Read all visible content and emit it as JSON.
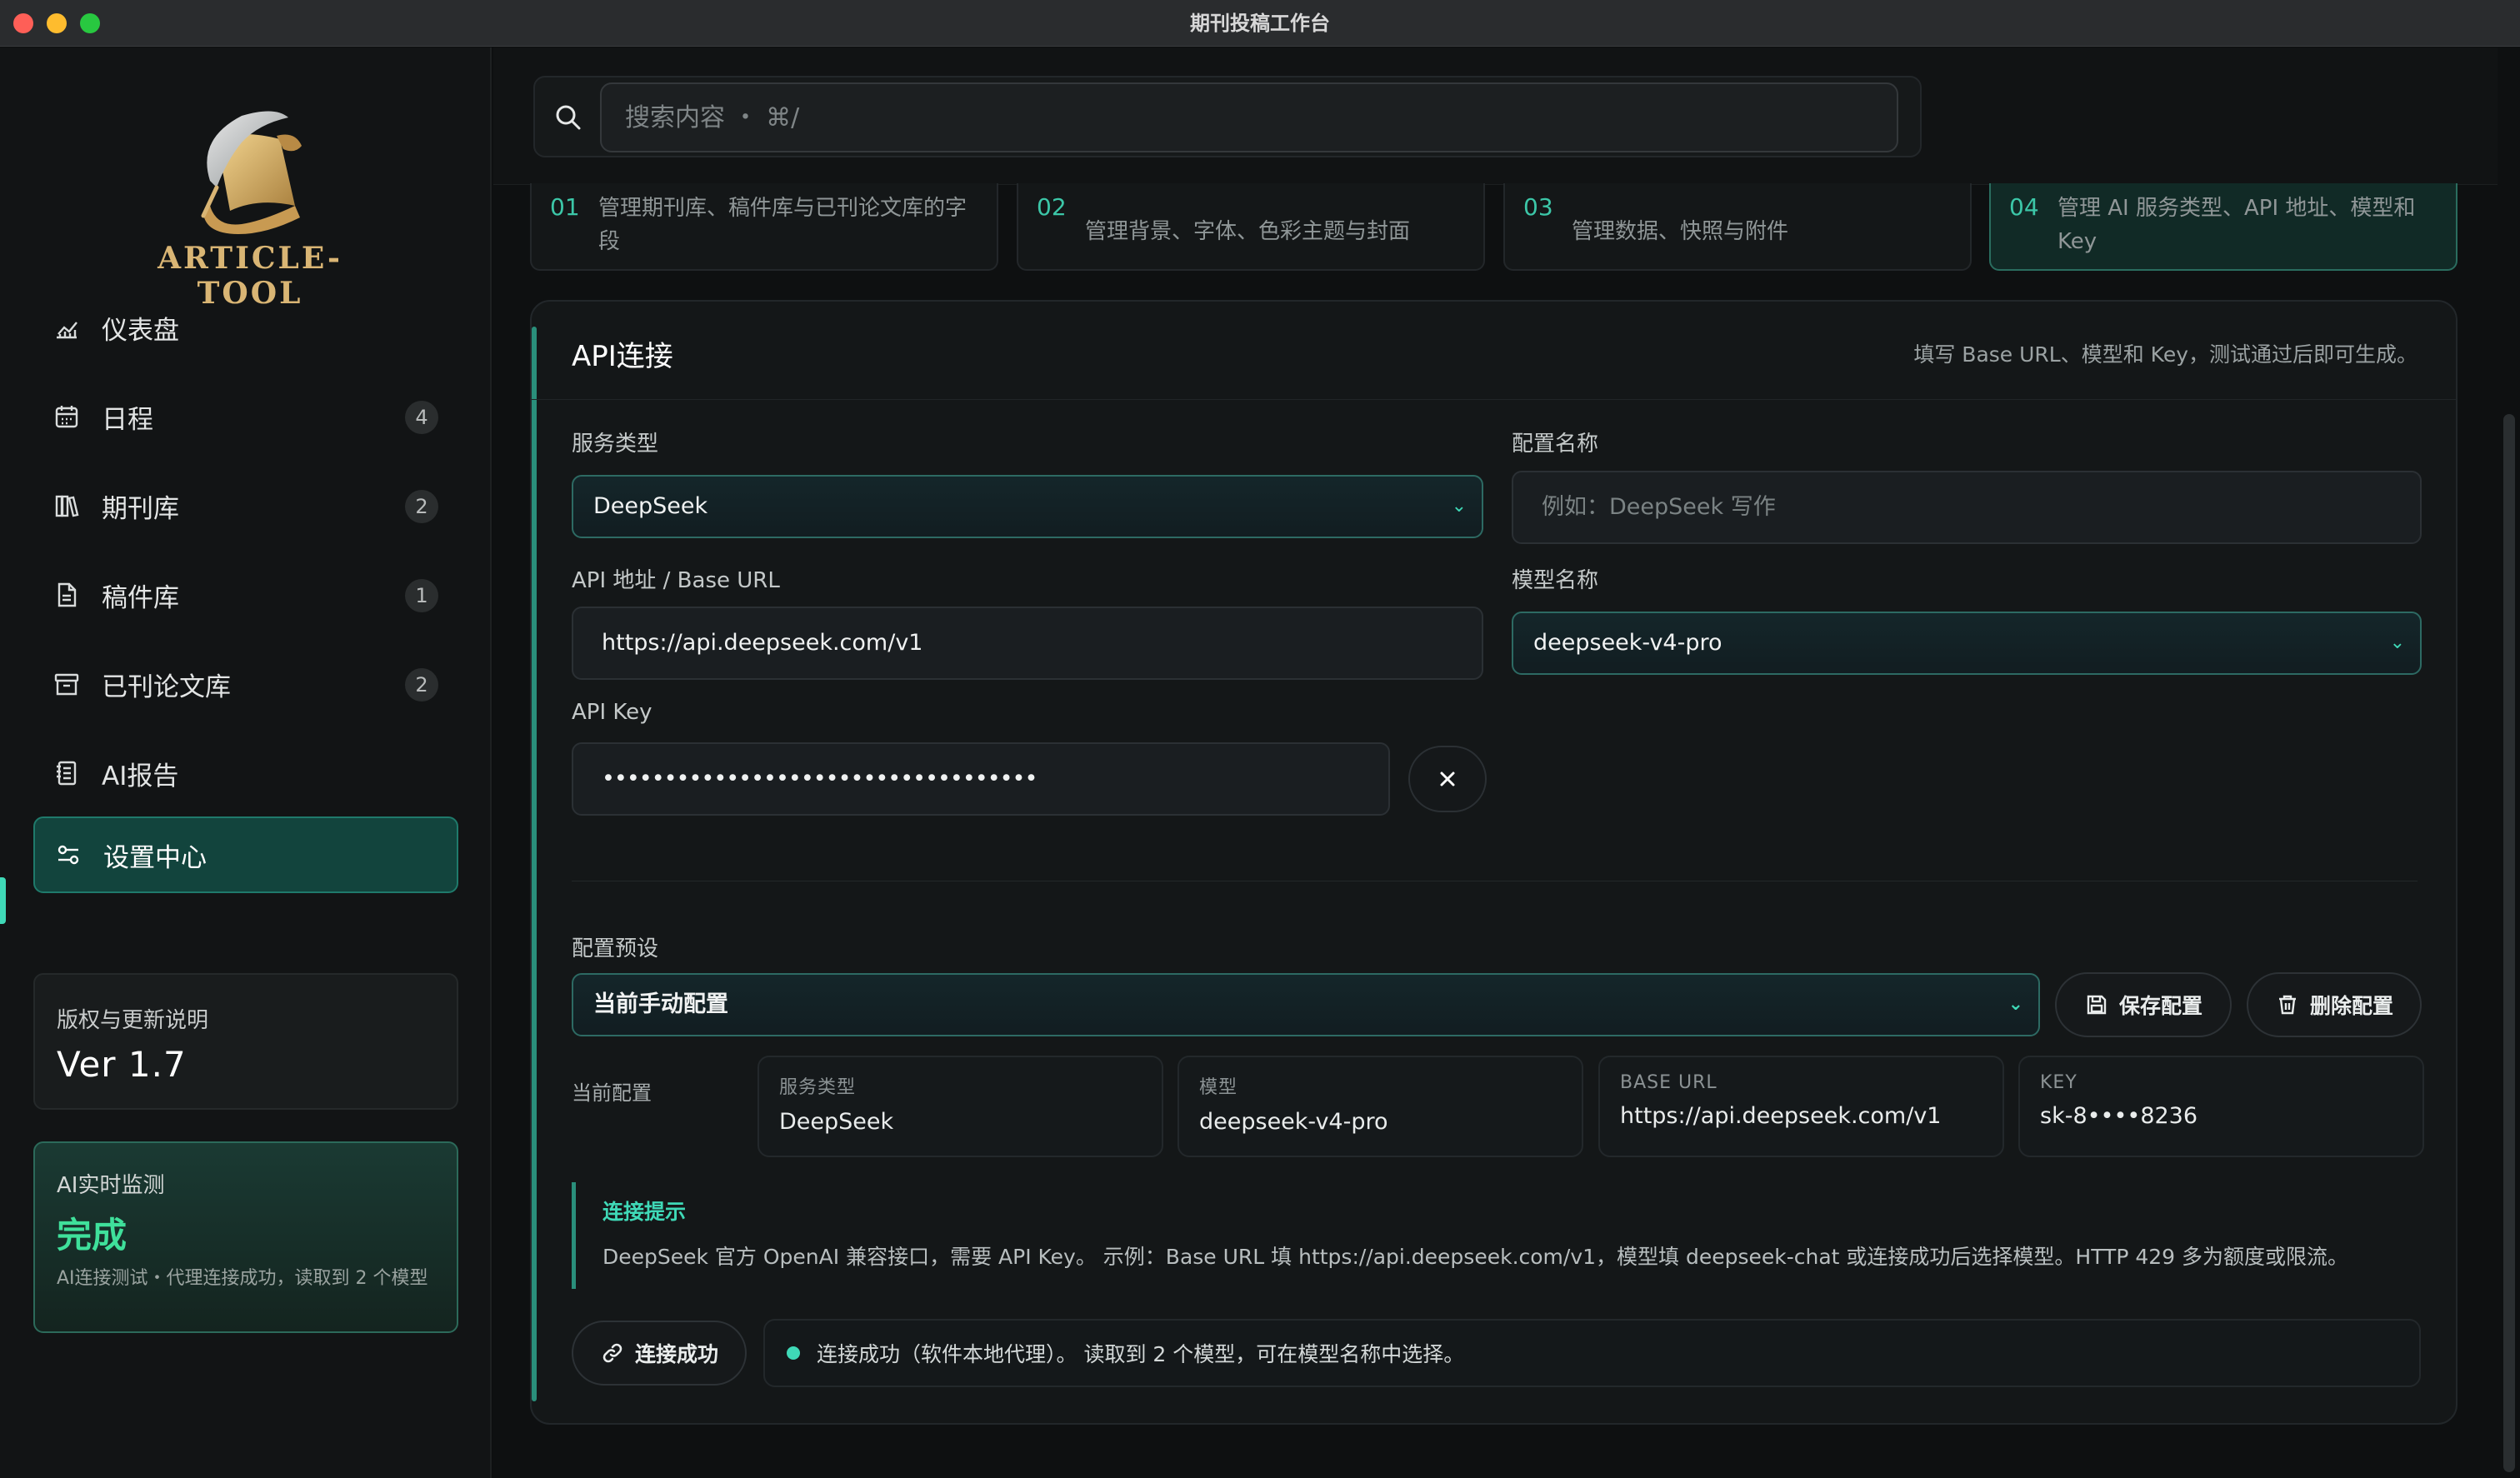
{
  "window": {
    "title": "期刊投稿工作台"
  },
  "brand": {
    "logo_text": "ARTICLE-TOOL"
  },
  "sidebar": {
    "items": [
      {
        "label": "仪表盘",
        "badge": null,
        "icon": "chart-icon"
      },
      {
        "label": "日程",
        "badge": "4",
        "icon": "calendar-icon"
      },
      {
        "label": "期刊库",
        "badge": "2",
        "icon": "books-icon"
      },
      {
        "label": "稿件库",
        "badge": "1",
        "icon": "document-icon"
      },
      {
        "label": "已刊论文库",
        "badge": "2",
        "icon": "archive-icon"
      },
      {
        "label": "AI报告",
        "badge": null,
        "icon": "report-icon"
      },
      {
        "label": "设置中心",
        "badge": null,
        "icon": "settings-sliders-icon",
        "active": true
      }
    ],
    "version_card": {
      "label": "版权与更新说明",
      "value": "Ver 1.7"
    },
    "monitor_card": {
      "label": "AI实时监测",
      "status": "完成",
      "desc": "AI连接测试・代理连接成功，读取到 2 个模型"
    }
  },
  "search": {
    "placeholder": "搜索内容 ・ ⌘/"
  },
  "steps": [
    {
      "num": "01",
      "text": "管理期刊库、稿件库与已刊论文库的字段"
    },
    {
      "num": "02",
      "text": "管理背景、字体、色彩主题与封面"
    },
    {
      "num": "03",
      "text": "管理数据、快照与附件"
    },
    {
      "num": "04",
      "text": "管理 AI 服务类型、API 地址、模型和 Key",
      "active": true
    }
  ],
  "panel": {
    "title": "API连接",
    "hint": "填写 Base URL、模型和 Key，测试通过后即可生成。",
    "service_type": {
      "label": "服务类型",
      "value": "DeepSeek"
    },
    "config_name": {
      "label": "配置名称",
      "placeholder": "例如：DeepSeek 写作"
    },
    "base_url": {
      "label": "API 地址 / Base URL",
      "value": "https://api.deepseek.com/v1"
    },
    "model_name": {
      "label": "模型名称",
      "value": "deepseek-v4-pro"
    },
    "api_key": {
      "label": "API Key",
      "value": "•••••••••••••••••••••••••••••••••••"
    },
    "preset": {
      "label": "配置预设",
      "value": "当前手动配置",
      "save_label": "保存配置",
      "delete_label": "删除配置"
    },
    "current": {
      "label": "当前配置",
      "boxes": [
        {
          "label": "服务类型",
          "value": "DeepSeek"
        },
        {
          "label": "模型",
          "value": "deepseek-v4-pro"
        },
        {
          "label": "BASE URL",
          "value": "https://api.deepseek.com/v1"
        },
        {
          "label": "KEY",
          "value": "sk-8••••8236"
        }
      ]
    },
    "tip": {
      "title": "连接提示",
      "text": "DeepSeek 官方 OpenAI 兼容接口，需要 API Key。 示例：Base URL 填 https://api.deepseek.com/v1，模型填 deepseek-chat 或连接成功后选择模型。HTTP 429 多为额度或限流。"
    },
    "connect": {
      "button_label": "连接成功",
      "status_text": "连接成功（软件本地代理）。 读取到 2 个模型，可在模型名称中选择。"
    }
  },
  "colors": {
    "accent": "#3fd9b7",
    "logo_gold": "#d9b574",
    "success": "#3fe09b"
  }
}
